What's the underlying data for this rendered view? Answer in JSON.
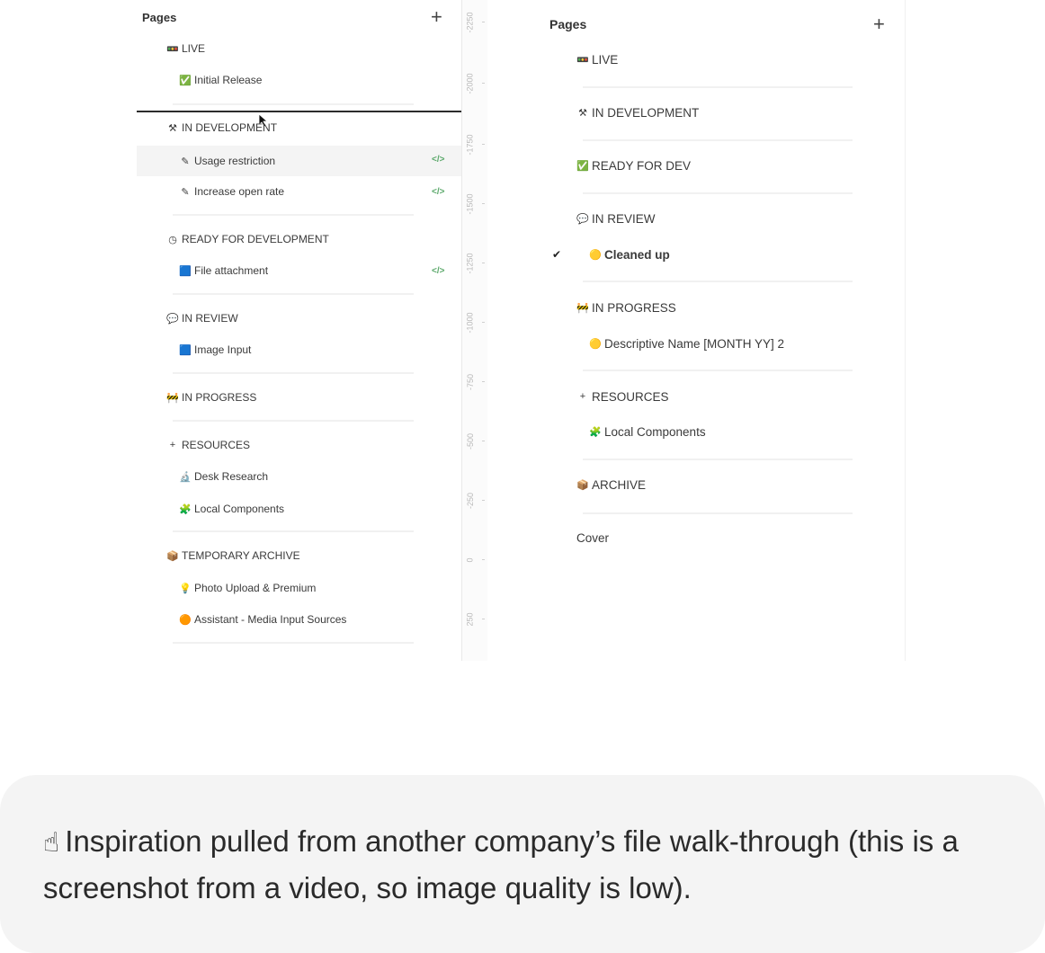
{
  "left_panel": {
    "title": "Pages",
    "add_glyph": "+",
    "items": [
      {
        "label": "LIVE",
        "icon": "🚥"
      },
      {
        "label": "Initial Release",
        "icon": "✅"
      },
      {
        "label": "IN DEVELOPMENT",
        "icon": "⚒"
      },
      {
        "label": "Usage restriction",
        "icon": "✎",
        "selected": true
      },
      {
        "label": "Increase open rate",
        "icon": "✎"
      },
      {
        "label": "READY FOR DEVELOPMENT",
        "icon": "◷"
      },
      {
        "label": "File attachment",
        "icon": "🟦"
      },
      {
        "label": "IN REVIEW",
        "icon": "💬"
      },
      {
        "label": "Image Input",
        "icon": "🟦"
      },
      {
        "label": "IN PROGRESS",
        "icon": "🚧"
      },
      {
        "label": "RESOURCES",
        "icon": "+"
      },
      {
        "label": "Desk Research",
        "icon": "🔬"
      },
      {
        "label": "Local Components",
        "icon": "🧩"
      },
      {
        "label": "TEMPORARY ARCHIVE",
        "icon": "📦"
      },
      {
        "label": "Photo Upload & Premium",
        "icon": "💡"
      },
      {
        "label": "Assistant - Media Input Sources",
        "icon": "🟠"
      }
    ],
    "code_glyph": "</>"
  },
  "ruler": {
    "labels": [
      "-2250",
      "-2000",
      "-1750",
      "-1500",
      "-1250",
      "-1000",
      "-750",
      "-500",
      "-250",
      "0",
      "250"
    ]
  },
  "right_panel": {
    "title": "Pages",
    "add_glyph": "+",
    "check_glyph": "✔",
    "items": [
      {
        "label": "LIVE",
        "icon": "🚥"
      },
      {
        "label": "IN DEVELOPMENT",
        "icon": "⚒"
      },
      {
        "label": "READY FOR DEV",
        "icon": "✅"
      },
      {
        "label": "IN REVIEW",
        "icon": "💬"
      },
      {
        "label": "Cleaned up",
        "icon": "🟡",
        "checked": true
      },
      {
        "label": "IN PROGRESS",
        "icon": "🚧"
      },
      {
        "label": "Descriptive Name [MONTH YY] 2",
        "icon": "🟡"
      },
      {
        "label": "RESOURCES",
        "icon": "+"
      },
      {
        "label": "Local Components",
        "icon": "🧩"
      },
      {
        "label": "ARCHIVE",
        "icon": "📦"
      },
      {
        "label": "Cover",
        "icon": ""
      }
    ]
  },
  "note": {
    "emoji": "☝",
    "text": "Inspiration pulled from another company’s file walk-through (this is a screenshot from a video, so image quality is low)."
  },
  "colors": {
    "selected_row": "#f4f4f4",
    "code_icon": "#5aa86a",
    "note_bg": "#f4f4f4"
  }
}
